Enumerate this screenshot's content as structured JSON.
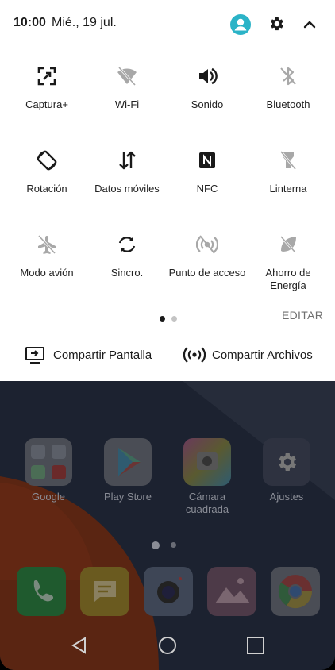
{
  "status": {
    "time": "10:00",
    "date": "Mié., 19 jul."
  },
  "tiles": [
    {
      "label": "Captura+",
      "icon": "capture-icon",
      "active": true
    },
    {
      "label": "Wi-Fi",
      "icon": "wifi-off-icon",
      "active": false
    },
    {
      "label": "Sonido",
      "icon": "volume-icon",
      "active": true
    },
    {
      "label": "Bluetooth",
      "icon": "bluetooth-off-icon",
      "active": false
    },
    {
      "label": "Rotación",
      "icon": "rotation-icon",
      "active": true
    },
    {
      "label": "Datos móviles",
      "icon": "mobile-data-icon",
      "active": true
    },
    {
      "label": "NFC",
      "icon": "nfc-icon",
      "active": true
    },
    {
      "label": "Linterna",
      "icon": "flashlight-off-icon",
      "active": false
    },
    {
      "label": "Modo avión",
      "icon": "airplane-off-icon",
      "active": false
    },
    {
      "label": "Sincro.",
      "icon": "sync-icon",
      "active": true
    },
    {
      "label": "Punto de acceso",
      "icon": "hotspot-off-icon",
      "active": false
    },
    {
      "label": "Ahorro de Energía",
      "icon": "battery-saver-off-icon",
      "active": false
    }
  ],
  "pager": {
    "pages": 2,
    "current": 1
  },
  "edit_label": "EDITAR",
  "share": {
    "screen_label": "Compartir Pantalla",
    "files_label": "Compartir Archivos"
  },
  "home": {
    "apps": [
      {
        "name": "Google"
      },
      {
        "name": "Play Store"
      },
      {
        "name": "Cámara cuadrada"
      },
      {
        "name": "Ajustes"
      }
    ],
    "dock": [
      "Teléfono",
      "Mensajes",
      "Cámara",
      "Galería",
      "Chrome"
    ]
  },
  "colors": {
    "accent": "#2bb3c7",
    "active_icon": "#1a1a1a",
    "inactive_icon": "#a8a8a8"
  }
}
